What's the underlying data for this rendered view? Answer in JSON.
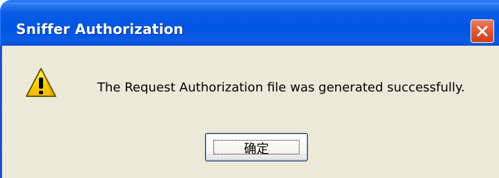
{
  "window": {
    "title": "Sniffer Authorization",
    "close_icon": "close-icon"
  },
  "dialog": {
    "icon": "warning-icon",
    "message": "The Request Authorization file was generated successfully.",
    "ok_label": "确定"
  },
  "colors": {
    "titlebar": "#0054e3",
    "client": "#ece9d8",
    "close_button": "#df5b36",
    "warning_fill": "#ffd800"
  }
}
